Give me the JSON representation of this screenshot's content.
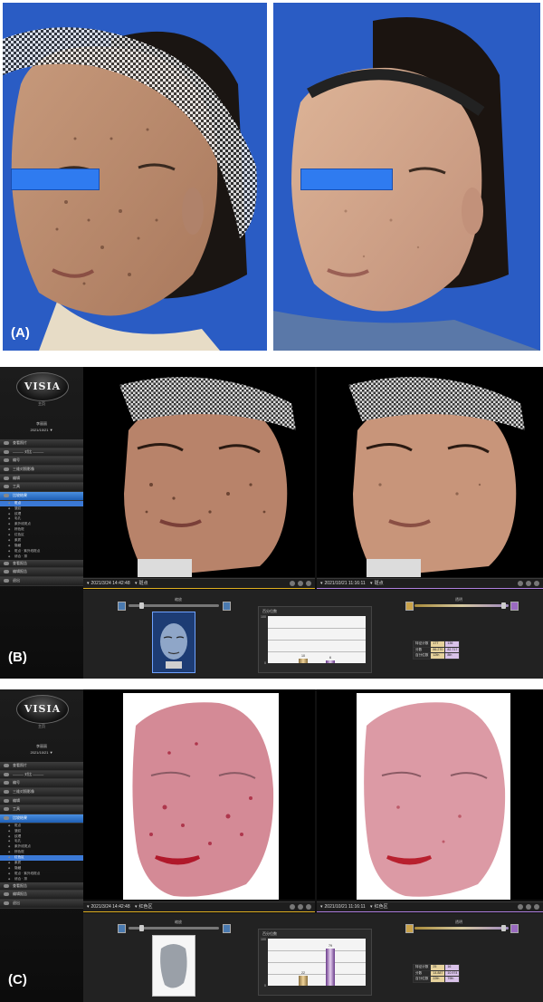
{
  "panels": {
    "a": "(A)",
    "b": "(B)",
    "c": "(C)"
  },
  "visia": {
    "logo": "VISIA",
    "home": "主页",
    "user": "李丽丽",
    "date": "2021/10/21 ▼",
    "menu": [
      "查看照片",
      "——— 对比 ———",
      "编号",
      "三维对照影像",
      "编辑",
      "工具"
    ],
    "results_label": "比较结果",
    "sub_items": [
      "斑点",
      "皱纹",
      "纹理",
      "毛孔",
      "紫外线斑点",
      "棕色斑",
      "红色区",
      "紫质",
      "隐藏",
      "斑点 · 紫外线斑点",
      "综合 · 排"
    ],
    "bottom_menu": [
      "查看报告",
      "编辑报告",
      "退出"
    ]
  },
  "b": {
    "left_date": "2021/3/24 14:42:48",
    "left_mode": "斑点",
    "right_date": "2021/10/21 11:16:11",
    "right_mode": "斑点",
    "slider_label": "缩放",
    "slider_label_r": "透明",
    "chart_title": "百分位数",
    "ymax": "100",
    "ymin": "0",
    "chart_data": {
      "type": "bar",
      "values": [
        10,
        6
      ]
    },
    "bar_labels": [
      "10",
      "6"
    ],
    "table": [
      [
        "特征计数",
        "177",
        "136"
      ],
      [
        "分数",
        "86.270",
        "82.717"
      ],
      [
        "百分位数",
        "12th",
        "8th"
      ]
    ]
  },
  "c": {
    "left_date": "2021/3/24 14:42:48",
    "left_mode": "红色区",
    "right_date": "2021/10/21 11:16:11",
    "right_mode": "红色区",
    "slider_label": "缩放",
    "slider_label_r": "透明",
    "chart_title": "百分位数",
    "ymax": "100",
    "ymin": "0",
    "chart_data": {
      "type": "bar",
      "values": [
        22,
        79
      ]
    },
    "bar_labels": [
      "22",
      "79"
    ],
    "table": [
      [
        "特征计数",
        "25",
        "16"
      ],
      [
        "分数",
        "14.887",
        "10.974"
      ],
      [
        "百分位数",
        "22th",
        "79th"
      ]
    ]
  },
  "colors": {
    "accent_blue": "#3b79d6",
    "privacy_bar": "#2f7bf0",
    "left_series": "#e0b020",
    "right_series": "#b080e0"
  }
}
